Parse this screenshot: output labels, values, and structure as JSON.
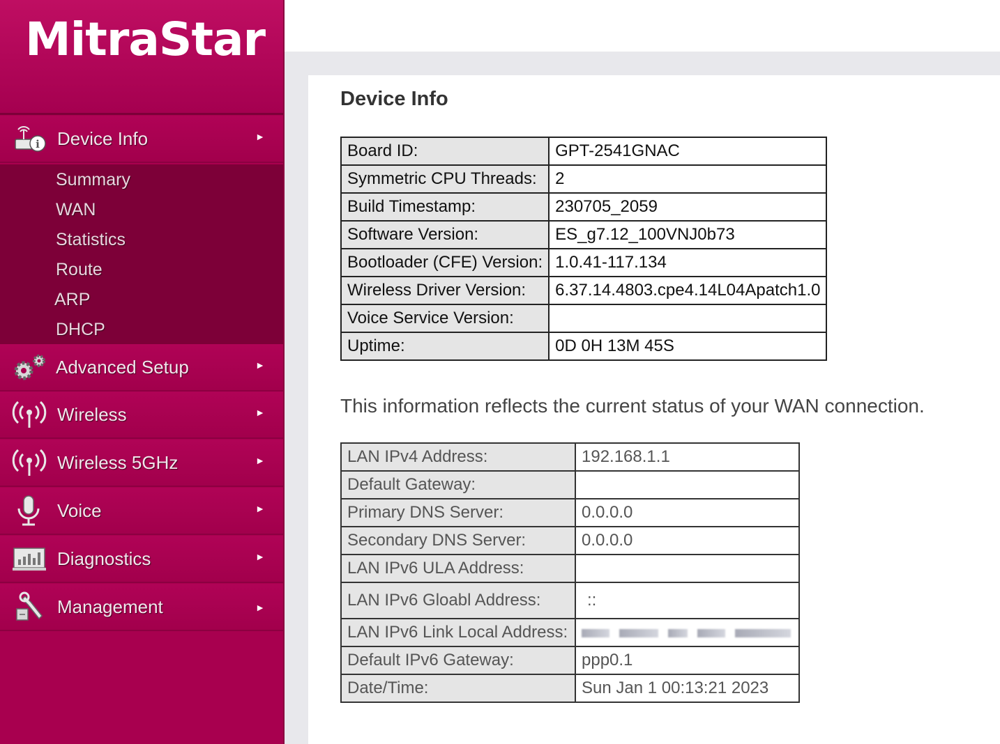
{
  "brand": {
    "logo_text": "MitraStar"
  },
  "sidebar": {
    "items": [
      {
        "label": "Device Info",
        "icon": "device-info-icon",
        "arrow": "►"
      },
      {
        "label": "Advanced Setup",
        "icon": "gears-icon",
        "arrow": "►"
      },
      {
        "label": "Wireless",
        "icon": "wireless-icon",
        "arrow": "►"
      },
      {
        "label": "Wireless 5GHz",
        "icon": "wireless-5ghz-icon",
        "arrow": "►"
      },
      {
        "label": "Voice",
        "icon": "microphone-icon",
        "arrow": "►"
      },
      {
        "label": "Diagnostics",
        "icon": "diagnostics-chart-icon",
        "arrow": "►"
      },
      {
        "label": "Management",
        "icon": "wrench-icon",
        "arrow": "►"
      }
    ],
    "submenu": [
      "Summary",
      "WAN",
      "Statistics",
      "Route",
      "ARP",
      "DHCP"
    ]
  },
  "main": {
    "title": "Device Info",
    "device_table": [
      {
        "label": "Board ID:",
        "value": "GPT-2541GNAC"
      },
      {
        "label": "Symmetric CPU Threads:",
        "value": "2"
      },
      {
        "label": "Build Timestamp:",
        "value": "230705_2059"
      },
      {
        "label": "Software Version:",
        "value": "ES_g7.12_100VNJ0b73"
      },
      {
        "label": "Bootloader (CFE) Version:",
        "value": "1.0.41-117.134"
      },
      {
        "label": "Wireless Driver Version:",
        "value": "6.37.14.4803.cpe4.14L04Apatch1.0"
      },
      {
        "label": "Voice Service Version:",
        "value": ""
      },
      {
        "label": "Uptime:",
        "value": "0D 0H 13M 45S"
      }
    ],
    "wan_note": "This information reflects the current status of your WAN connection.",
    "wan_table": [
      {
        "label": "LAN IPv4 Address:",
        "value": "192.168.1.1"
      },
      {
        "label": "Default Gateway:",
        "value": ""
      },
      {
        "label": "Primary DNS Server:",
        "value": "0.0.0.0"
      },
      {
        "label": "Secondary DNS Server:",
        "value": "0.0.0.0"
      },
      {
        "label": "LAN IPv6 ULA Address:",
        "value": ""
      },
      {
        "label": "LAN IPv6 Gloabl Address:",
        "value": "::"
      },
      {
        "label": "LAN IPv6 Link Local Address:",
        "value": ""
      },
      {
        "label": "Default IPv6 Gateway:",
        "value": "ppp0.1"
      },
      {
        "label": "Date/Time:",
        "value": "Sun Jan 1 00:13:21 2023"
      }
    ]
  },
  "colors": {
    "sidebar": "#a8004f",
    "submenu": "#7d0038",
    "label_cell": "#e5e5e5"
  }
}
